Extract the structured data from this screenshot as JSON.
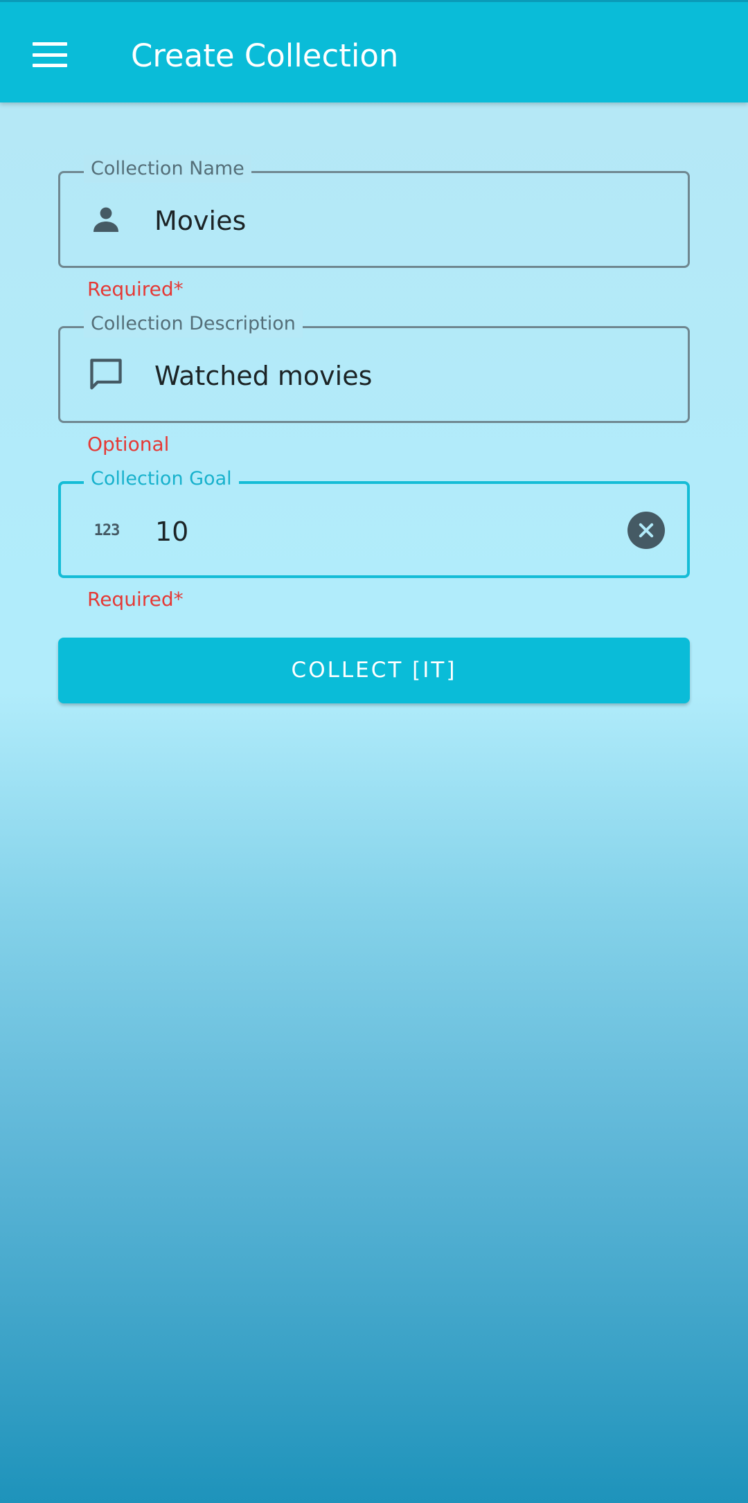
{
  "appbar": {
    "title": "Create Collection",
    "menu_icon": "menu-icon"
  },
  "form": {
    "name_field": {
      "label": "Collection Name",
      "value": "Movies",
      "icon": "person-icon",
      "helper": "Required*"
    },
    "description_field": {
      "label": "Collection Description",
      "value": "Watched movies",
      "icon": "comment-icon",
      "helper": "Optional"
    },
    "goal_field": {
      "label": "Collection Goal",
      "value": "10",
      "icon": "numbers-icon",
      "icon_text": "123",
      "clear_icon": "clear-icon",
      "helper": "Required*"
    },
    "submit_label": "COLLECT [IT]"
  },
  "colors": {
    "primary": "#0abcd8",
    "error": "#e53935",
    "icon": "#455a64"
  }
}
